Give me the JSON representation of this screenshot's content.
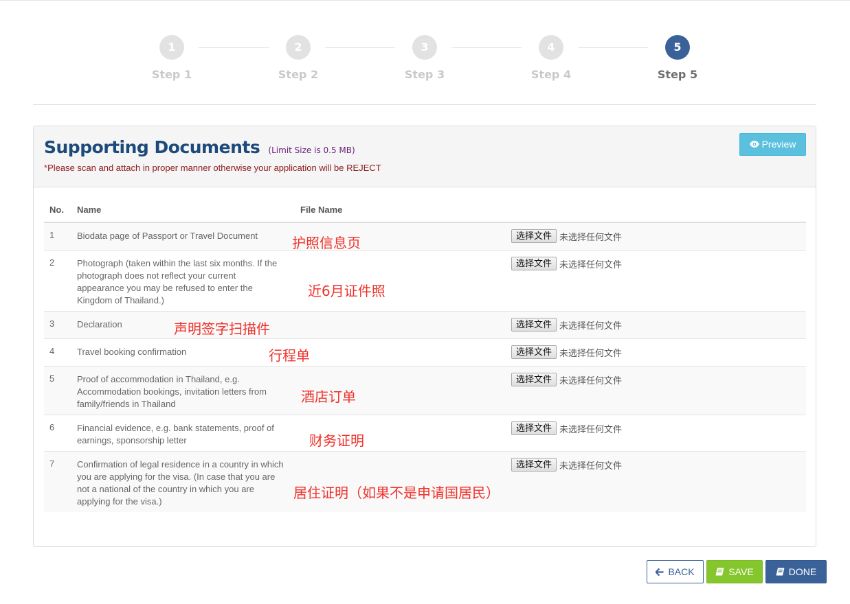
{
  "steps": [
    {
      "number": "1",
      "label": "Step 1"
    },
    {
      "number": "2",
      "label": "Step 2"
    },
    {
      "number": "3",
      "label": "Step 3"
    },
    {
      "number": "4",
      "label": "Step 4"
    },
    {
      "number": "5",
      "label": "Step 5"
    }
  ],
  "active_step": "5",
  "panel": {
    "title": "Supporting Documents",
    "limit": "(Limit Size is 0.5 MB)",
    "warning_star": "*",
    "warning": "Please scan and attach in proper manner otherwise your application will be REJECT",
    "preview_label": "Preview",
    "preview_icon": "eye-icon"
  },
  "table": {
    "headers": {
      "no": "No.",
      "name": "Name",
      "file": "File Name"
    },
    "file_button": "选择文件",
    "file_status": "未选择任何文件",
    "rows": [
      {
        "no": "1",
        "name": "Biodata page of Passport or Travel Document",
        "annotation": "护照信息页"
      },
      {
        "no": "2",
        "name": "Photograph (taken within the last six months. If the photograph does not reflect your current appearance you may be refused to enter the Kingdom of Thailand.)",
        "annotation": "近6月证件照"
      },
      {
        "no": "3",
        "name": "Declaration",
        "annotation": "声明签字扫描件"
      },
      {
        "no": "4",
        "name": "Travel booking confirmation",
        "annotation": "行程单"
      },
      {
        "no": "5",
        "name": "Proof of accommodation in Thailand, e.g. Accommodation bookings, invitation letters from family/friends in Thailand",
        "annotation": "酒店订单"
      },
      {
        "no": "6",
        "name": "Financial evidence, e.g. bank statements, proof of earnings, sponsorship letter",
        "annotation": "财务证明"
      },
      {
        "no": "7",
        "name": "Confirmation of legal residence in a country in which you are applying for the visa. (In case that you are not a national of the country in which you are applying for the visa.)",
        "annotation": "居住证明（如果不是申请国居民）"
      }
    ]
  },
  "buttons": {
    "back": "BACK",
    "save": "SAVE",
    "done": "DONE"
  },
  "colors": {
    "active_step": "#3b6199",
    "title": "#1d4a7a",
    "annotation": "#f0312a",
    "preview": "#5bc0de",
    "save": "#84c62b"
  }
}
